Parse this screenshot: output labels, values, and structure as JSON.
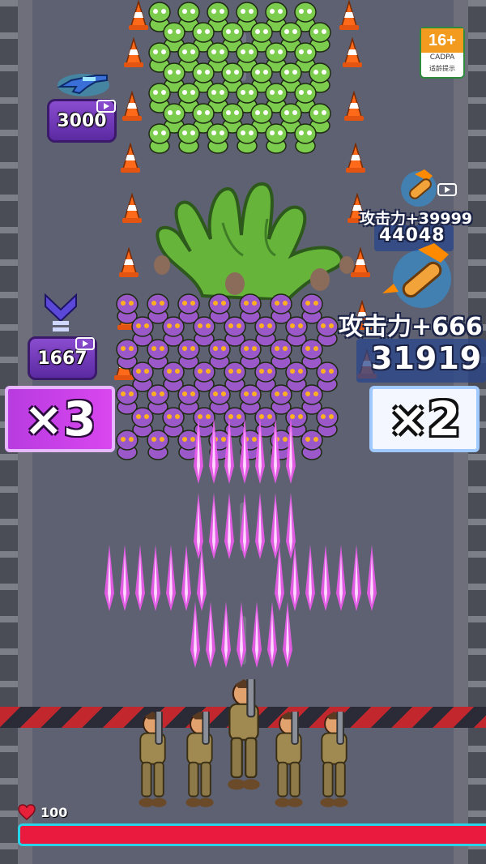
{
  "hud": {
    "age_rating": {
      "label": "16+",
      "org": "CADPA",
      "tip": "适龄提示"
    },
    "health": {
      "value": "100",
      "fill_fraction": 1.0,
      "bar_color": "#ea1a3f",
      "icon": "heart-icon"
    }
  },
  "pickups": [
    {
      "id": "weapon-crate",
      "value": "3000",
      "icon": "blaster-gun-icon"
    },
    {
      "id": "upgrade-crate",
      "value": "1667",
      "icon": "rank-chevron-icon"
    },
    {
      "id": "attack-bonus-small",
      "label": "攻击力+39999",
      "value": "44048",
      "icon": "bullet-icon"
    },
    {
      "id": "attack-bonus-large",
      "label": "攻击力+666",
      "value": "31919",
      "icon": "bullet-icon"
    }
  ],
  "gates": [
    {
      "id": "gate-left",
      "label": "×3",
      "color": "#d946ef"
    },
    {
      "id": "gate-right",
      "label": "×2",
      "color": "#f4f7ff"
    }
  ],
  "colors": {
    "road": "#5d6171",
    "zombie_green": "#7ccc4e",
    "zombie_purple": "#9a58c9",
    "projectile": "#f05cf0",
    "hazard_stripe": "#c1272d"
  }
}
